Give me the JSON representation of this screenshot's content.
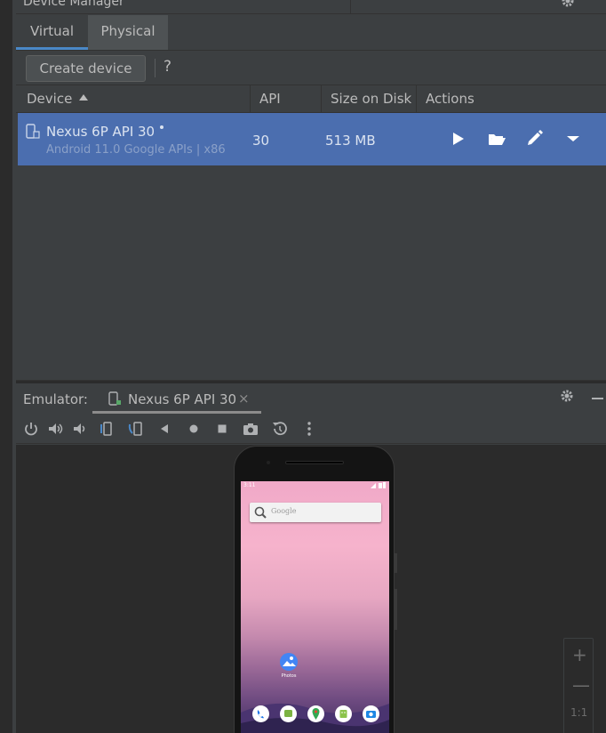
{
  "panel": {
    "title": "Device Manager"
  },
  "tabs": [
    {
      "label": "Virtual",
      "selected": true
    },
    {
      "label": "Physical",
      "selected": false
    }
  ],
  "toolbar": {
    "create_label": "Create device",
    "help_label": "?"
  },
  "table": {
    "columns": {
      "device": "Device",
      "api": "API",
      "size": "Size on Disk",
      "actions": "Actions"
    },
    "rows": [
      {
        "name": "Nexus 6P API 30",
        "subtitle": "Android 11.0 Google APIs | x86",
        "api": "30",
        "size": "513 MB",
        "selected": true
      }
    ]
  },
  "emulator": {
    "label": "Emulator:",
    "tab_name": "Nexus 6P API 30",
    "close_glyph": "×",
    "toolbar_icons": [
      "power-icon",
      "volume-up-icon",
      "volume-down-icon",
      "rotate-left-icon",
      "rotate-right-icon",
      "back-icon",
      "home-icon",
      "overview-icon",
      "screenshot-icon",
      "snapshot-icon",
      "more-icon"
    ]
  },
  "phone_screen": {
    "status_time": "3:11",
    "search_placeholder": "Google",
    "app_label": "Photos"
  },
  "zoom": {
    "plus": "+",
    "minus": "—",
    "one_to_one": "1:1"
  },
  "colors": {
    "selection": "#4b6eaf",
    "tab_underline": "#4a88c7",
    "background": "#3c3f41"
  }
}
